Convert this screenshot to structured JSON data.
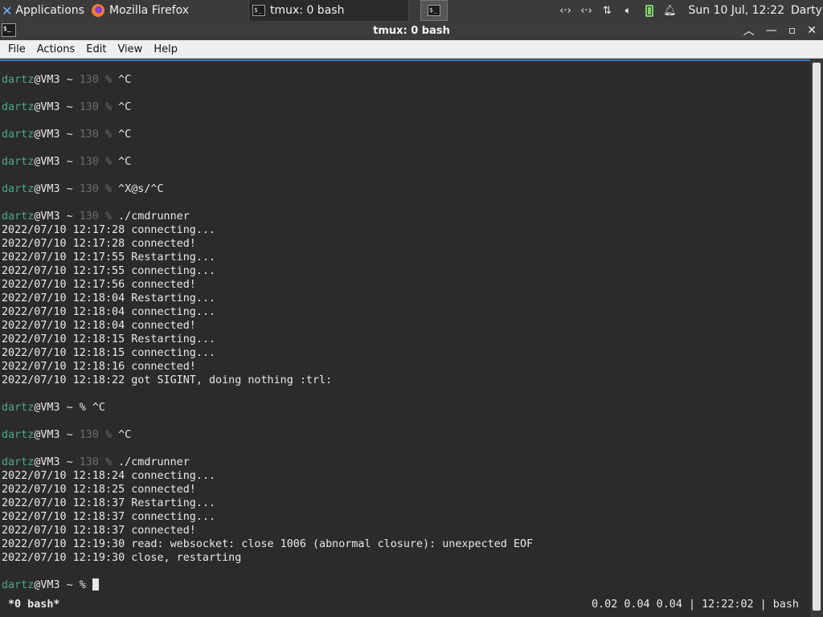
{
  "panel": {
    "applications_label": "Applications",
    "tasks": [
      {
        "label": "Mozilla Firefox",
        "icon": "firefox-icon"
      },
      {
        "label": "tmux: 0 bash",
        "icon": "terminal-icon"
      }
    ],
    "clock": "Sun 10 Jul, 12:22",
    "user": "Darty uwu",
    "tray_icons": [
      "network-icon",
      "network-icon",
      "transfer-icon",
      "volume-icon",
      "battery-icon",
      "notification-bell-icon"
    ]
  },
  "window": {
    "title": "tmux: 0 bash",
    "menus": [
      "File",
      "Actions",
      "Edit",
      "View",
      "Help"
    ]
  },
  "terminal": {
    "lines": [
      {
        "user": "dartz",
        "host": "@VM3 ~ ",
        "code": "130 % ",
        "cmd": "^C"
      },
      {
        "text": ""
      },
      {
        "user": "dartz",
        "host": "@VM3 ~ ",
        "code": "130 % ",
        "cmd": "^C"
      },
      {
        "text": ""
      },
      {
        "user": "dartz",
        "host": "@VM3 ~ ",
        "code": "130 % ",
        "cmd": "^C"
      },
      {
        "text": ""
      },
      {
        "user": "dartz",
        "host": "@VM3 ~ ",
        "code": "130 % ",
        "cmd": "^C"
      },
      {
        "text": ""
      },
      {
        "user": "dartz",
        "host": "@VM3 ~ ",
        "code": "130 % ",
        "cmd": "^X@s/^C"
      },
      {
        "text": ""
      },
      {
        "user": "dartz",
        "host": "@VM3 ~ ",
        "code": "130 % ",
        "cmd": "./cmdrunner"
      },
      {
        "text": "2022/07/10 12:17:28 connecting..."
      },
      {
        "text": "2022/07/10 12:17:28 connected!"
      },
      {
        "text": "2022/07/10 12:17:55 Restarting..."
      },
      {
        "text": "2022/07/10 12:17:55 connecting..."
      },
      {
        "text": "2022/07/10 12:17:56 connected!"
      },
      {
        "text": "2022/07/10 12:18:04 Restarting..."
      },
      {
        "text": "2022/07/10 12:18:04 connecting..."
      },
      {
        "text": "2022/07/10 12:18:04 connected!"
      },
      {
        "text": "2022/07/10 12:18:15 Restarting..."
      },
      {
        "text": "2022/07/10 12:18:15 connecting..."
      },
      {
        "text": "2022/07/10 12:18:16 connected!"
      },
      {
        "text": "2022/07/10 12:18:22 got SIGINT, doing nothing :trl:"
      },
      {
        "text": ""
      },
      {
        "user": "dartz",
        "host": "@VM3 ~ ",
        "code": "",
        "cmd": "% ^C"
      },
      {
        "text": ""
      },
      {
        "user": "dartz",
        "host": "@VM3 ~ ",
        "code": "130 % ",
        "cmd": "^C"
      },
      {
        "text": ""
      },
      {
        "user": "dartz",
        "host": "@VM3 ~ ",
        "code": "130 % ",
        "cmd": "./cmdrunner"
      },
      {
        "text": "2022/07/10 12:18:24 connecting..."
      },
      {
        "text": "2022/07/10 12:18:25 connected!"
      },
      {
        "text": "2022/07/10 12:18:37 Restarting..."
      },
      {
        "text": "2022/07/10 12:18:37 connecting..."
      },
      {
        "text": "2022/07/10 12:18:37 connected!"
      },
      {
        "text": "2022/07/10 12:19:30 read: websocket: close 1006 (abnormal closure): unexpected EOF"
      },
      {
        "text": "2022/07/10 12:19:30 close, restarting"
      },
      {
        "text": ""
      },
      {
        "user": "dartz",
        "host": "@VM3 ~ ",
        "code": "",
        "cmd": "% ",
        "cursor": true
      }
    ]
  },
  "status": {
    "left": "*0 bash*",
    "right": "0.02 0.04 0.04 | 12:22:02 | bash"
  },
  "colors": {
    "accent": "#3d7fc4",
    "prompt_user": "#4aa88a",
    "exit_code": "#6b6b6b"
  }
}
